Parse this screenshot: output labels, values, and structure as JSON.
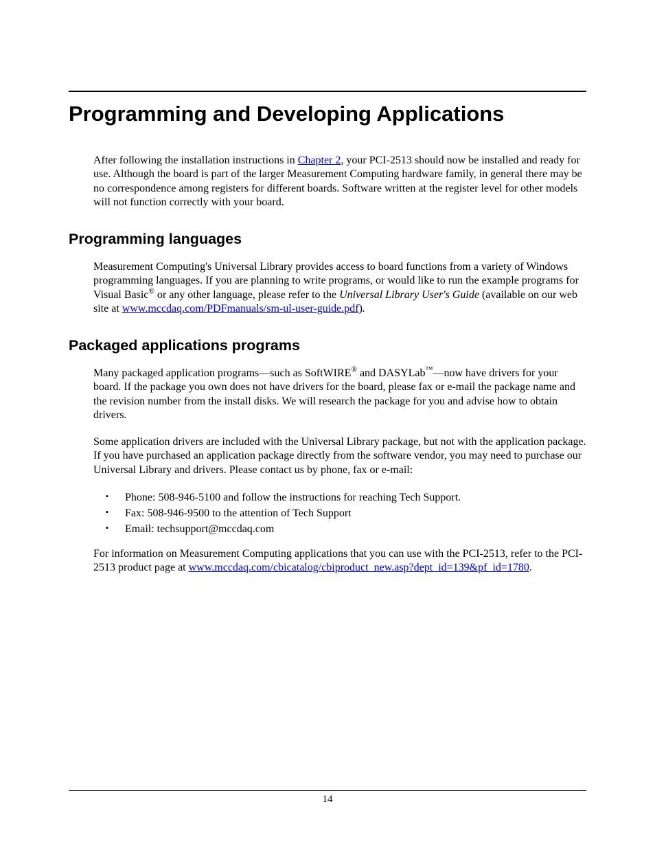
{
  "title": "Programming and Developing Applications",
  "intro": {
    "pre": "After following the installation instructions in ",
    "link": "Chapter 2",
    "post": ", your PCI-2513 should now be installed and ready for use. Although the board is part of the larger Measurement Computing hardware family, in general there may be no correspondence among registers for different boards. Software written at the register level for other models will not function correctly with your board."
  },
  "section1": {
    "heading": "Programming languages",
    "p1_a": "Measurement Computing's Universal Library provides access to board functions from a variety of Windows programming languages. If you are planning to write programs, or would like to run the example programs for Visual Basic",
    "p1_sup": "®",
    "p1_b": " or any other language, please refer to the ",
    "p1_em": "Universal Library User's Guide",
    "p1_c": " (available on our web site at ",
    "p1_link": "www.mccdaq.com/PDFmanuals/sm-ul-user-guide.pdf",
    "p1_d": ")",
    "p1_e": "."
  },
  "section2": {
    "heading": "Packaged applications programs",
    "p1_a": "Many packaged application programs—such as SoftWIRE",
    "p1_sup1": "®",
    "p1_b": " and DASYLab",
    "p1_sup2": "™",
    "p1_c": "—now have drivers for your board. If the package you own does not have drivers for the board, please fax or e-mail the package name and the revision number from the install disks. We will research the package for you and advise how to obtain drivers.",
    "p2": "Some application drivers are included with the Universal Library package, but not with the application package. If you have purchased an application package directly from the software vendor, you may need to purchase our Universal Library and drivers. Please contact us by phone, fax or e-mail:",
    "contacts": {
      "phone": "Phone: 508-946-5100 and follow the instructions for reaching Tech Support.",
      "fax": "Fax: 508-946-9500 to the attention of Tech Support",
      "email": "Email: techsupport@mccdaq.com"
    },
    "p3_a": "For information on Measurement Computing applications that you can use with the PCI-2513, refer to the PCI-2513 product page at ",
    "p3_link": "www.mccdaq.com/cbicatalog/cbiproduct_new.asp?dept_id=139&pf_id=1780",
    "p3_b": "."
  },
  "page_number": "14"
}
